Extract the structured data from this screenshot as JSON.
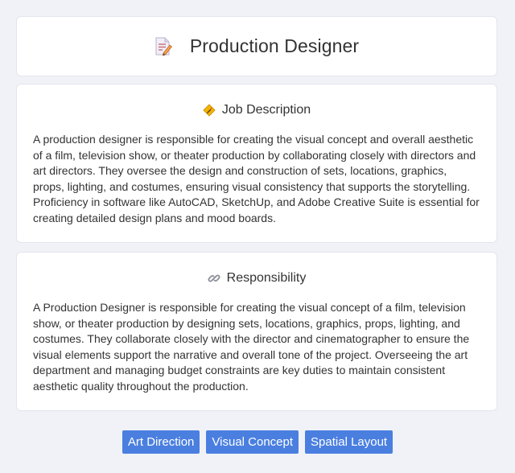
{
  "header": {
    "title": "Production Designer",
    "icon": "document-pencil-icon"
  },
  "job_description": {
    "icon": "pencil-sign-icon",
    "title": "Job Description",
    "body": "A production designer is responsible for creating the visual concept and overall aesthetic of a film, television show, or theater production by collaborating closely with directors and art directors. They oversee the design and construction of sets, locations, graphics, props, lighting, and costumes, ensuring visual consistency that supports the storytelling. Proficiency in software like AutoCAD, SketchUp, and Adobe Creative Suite is essential for creating detailed design plans and mood boards."
  },
  "responsibility": {
    "icon": "link-icon",
    "title": "Responsibility",
    "body": "A Production Designer is responsible for creating the visual concept of a film, television show, or theater production by designing sets, locations, graphics, props, lighting, and costumes. They collaborate closely with the director and cinematographer to ensure the visual elements support the narrative and overall tone of the project. Overseeing the art department and managing budget constraints are key duties to maintain consistent aesthetic quality throughout the production."
  },
  "tags": [
    "Art Direction",
    "Visual Concept",
    "Spatial Layout"
  ],
  "colors": {
    "background": "#f0f2f8",
    "tag_background": "#4a7fe0",
    "tag_text": "#ffffff"
  }
}
